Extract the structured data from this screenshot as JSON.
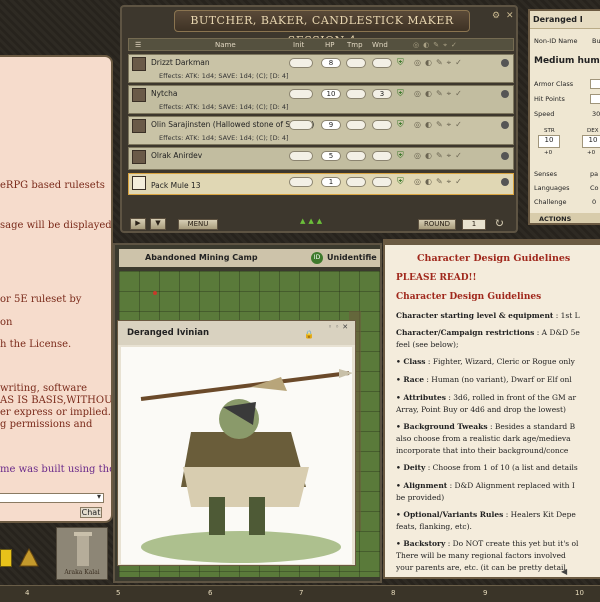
{
  "chat": {
    "lines": [
      "eRPG based rulesets",
      "sage will be displayed",
      "or 5E ruleset by",
      "on",
      "h the License.",
      "writing, software",
      "AS IS BASIS,WITHOUT",
      "er express or implied.",
      "g permissions and",
      "me was built using the"
    ],
    "send_label": "Chat"
  },
  "combat_tracker": {
    "title": "BUTCHER, BAKER, CANDLESTICK MAKER SESSION 4",
    "columns": {
      "name": "Name",
      "init": "Init",
      "hp": "HP",
      "temp": "Tmp",
      "wounds": "Wnd"
    },
    "rows": [
      {
        "name": "Drizzt Darkman",
        "effects": "Effects: ATK: 1d4; SAVE: 1d4; (C); [D: 4]",
        "hp": "8",
        "wounds": ""
      },
      {
        "name": "Nytcha",
        "effects": "Effects: ATK: 1d4; SAVE: 1d4; (C); [D: 4]",
        "hp": "10",
        "wounds": "3"
      },
      {
        "name": "Olin Sarajinsten (Hallowed stone of Sarajin)",
        "effects": "Effects: ATK: 1d4; SAVE: 1d4; (C); [D: 4]",
        "hp": "9",
        "wounds": ""
      },
      {
        "name": "Olrak Anirdev",
        "effects": "",
        "hp": "5",
        "wounds": ""
      },
      {
        "name": "Pack Mule 13",
        "effects": "",
        "hp": "1",
        "wounds": ""
      }
    ],
    "menu_label": "MENU",
    "round_label": "ROUND",
    "round_value": "1"
  },
  "sheet": {
    "title": "Deranged I",
    "nonid_label": "Non-ID Name",
    "nonid_value": "Bu",
    "type": "Medium hum",
    "armor_class_label": "Armor Class",
    "hit_points_label": "Hit Points",
    "speed_label": "Speed",
    "speed_value": "30",
    "str_label": "STR",
    "str_value": "10",
    "str_mod": "+0",
    "dex_label": "DEX",
    "dex_value": "10",
    "dex_mod": "+0",
    "senses_label": "Senses",
    "senses_value": "pa",
    "languages_label": "Languages",
    "languages_value": "Co",
    "challenge_label": "Challenge",
    "challenge_value": "0",
    "actions_label": "ACTIONS"
  },
  "map": {
    "title": "Abandoned Mining Camp",
    "id_label": "Unidentifie"
  },
  "image_window": {
    "title": "Deranged Ivinian"
  },
  "story": {
    "title": "Character Design Guidelines",
    "please_read": "PLEASE READ!!",
    "heading": "Character Design Guidelines",
    "lines": [
      {
        "b": "Character starting level & equipment",
        "r": " : 1st L"
      },
      {
        "b": "Character/Campaign restrictions",
        "r": " : A D&D 5e"
      },
      {
        "b": "",
        "r": "feel (see below);"
      },
      {
        "b": "• Class",
        "r": " : Fighter, Wizard, Cleric or Rogue only"
      },
      {
        "b": "• Race",
        "r": " : Human (no variant), Dwarf or Elf onl"
      },
      {
        "b": "• Attributes",
        "r": " : 3d6, rolled in front of the GM ar"
      },
      {
        "b": "",
        "r": "Array, Point Buy or 4d6 and drop the lowest)"
      },
      {
        "b": "• Background Tweaks",
        "r": " : Besides a standard B"
      },
      {
        "b": "",
        "r": "also choose from a realistic dark age/medieva"
      },
      {
        "b": "",
        "r": "incorporate that into their background/conce"
      },
      {
        "b": "• Deity",
        "r": " : Choose from 1 of 10 (a list and details"
      },
      {
        "b": "• Alignment",
        "r": " : D&D Alignment replaced with I"
      },
      {
        "b": "",
        "r": "be provided)"
      },
      {
        "b": "• Optional/Variants Rules",
        "r": " : Healers Kit Depe"
      },
      {
        "b": "",
        "r": "feats, flanking, etc)."
      },
      {
        "b": "• Backstory",
        "r": " : Do NOT create this yet but it's ol"
      },
      {
        "b": "",
        "r": "There will be many regional factors involved"
      },
      {
        "b": "",
        "r": "your parents are, etc.  (it can be pretty detail"
      }
    ]
  },
  "sidebar_portrait": {
    "caption": "Araka Kalai"
  },
  "hotbar": {
    "numbers": [
      "4",
      "5",
      "6",
      "7",
      "8",
      "9",
      "10"
    ]
  },
  "colors": {
    "accent": "#a0281c",
    "parchment": "#f4ecdc",
    "frame": "#3d372d"
  }
}
